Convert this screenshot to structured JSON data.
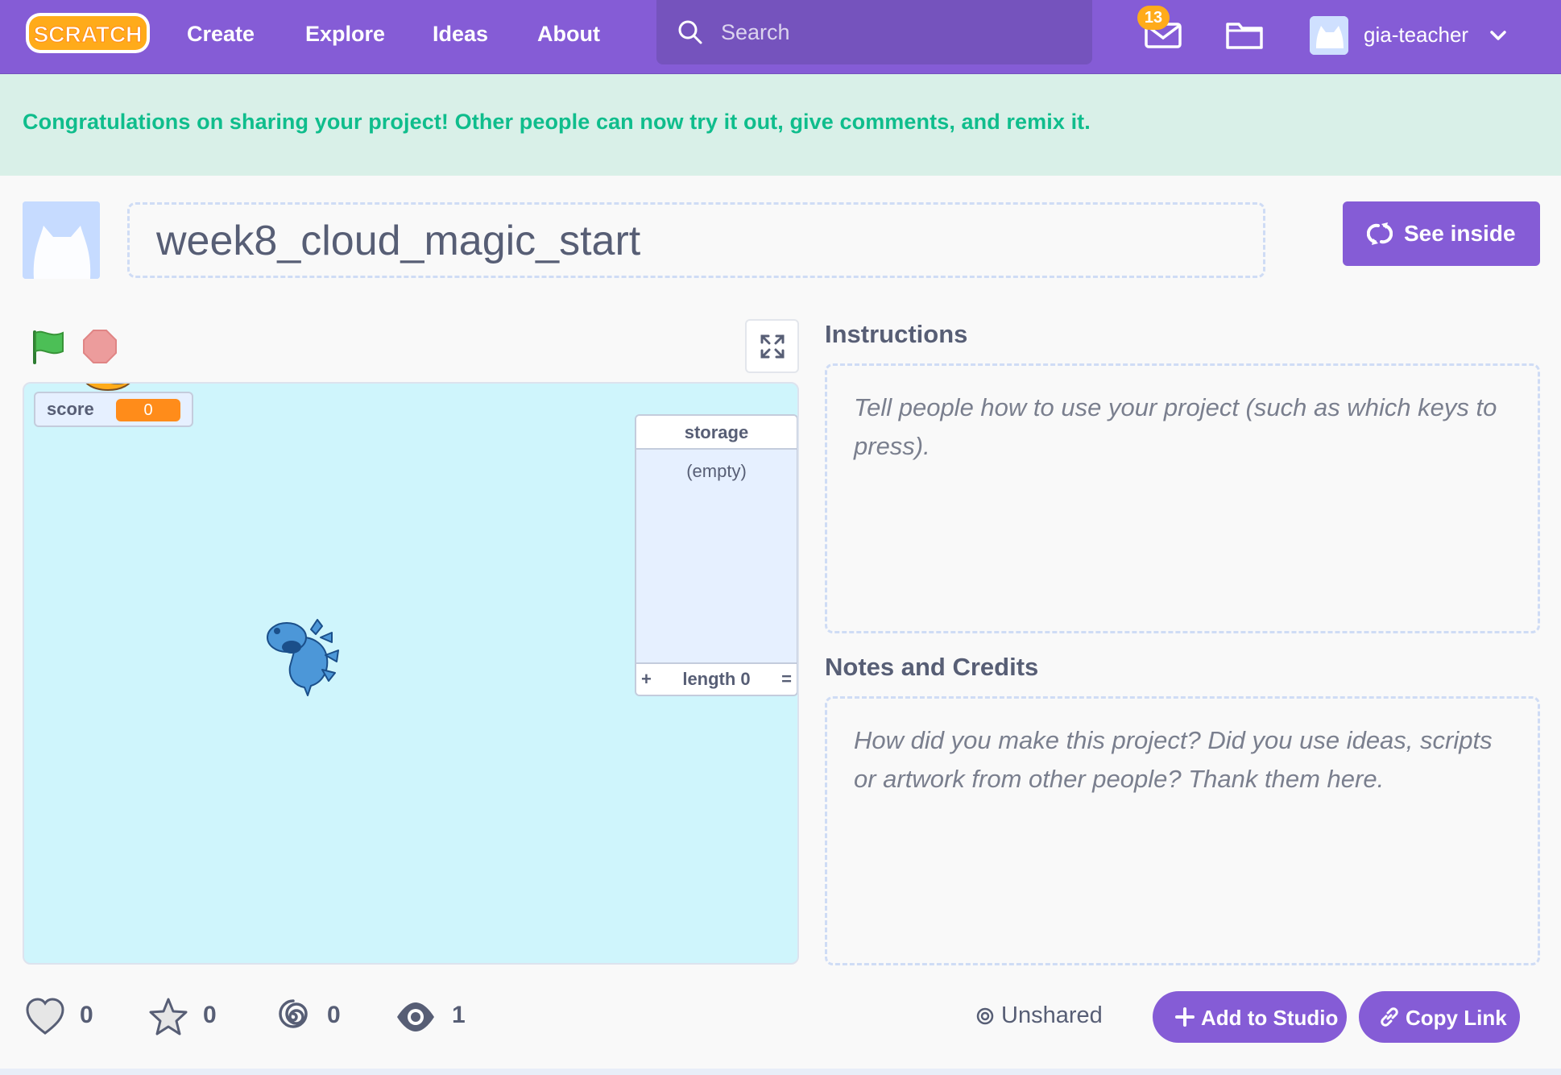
{
  "navbar": {
    "logo_text": "Scratch",
    "links": [
      "Create",
      "Explore",
      "Ideas",
      "About"
    ],
    "search_placeholder": "Search",
    "messages_count": "13",
    "username": "gia-teacher"
  },
  "banner": {
    "text": "Congratulations on sharing your project! Other people can now try it out, give comments, and remix it."
  },
  "project": {
    "title": "week8_cloud_magic_start",
    "see_inside_label": "See inside"
  },
  "stage": {
    "score_monitor": {
      "label": "score",
      "value": "0"
    },
    "list_monitor": {
      "name": "storage",
      "empty_text": "(empty)",
      "add_symbol": "+",
      "length_text": "length 0",
      "resize_symbol": "="
    }
  },
  "instructions": {
    "heading": "Instructions",
    "placeholder": "Tell people how to use your project (such as which keys to press)."
  },
  "notes": {
    "heading": "Notes and Credits",
    "placeholder": "How did you make this project? Did you use ideas, scripts or artwork from other people? Thank them here."
  },
  "stats": {
    "loves": "0",
    "favorites": "0",
    "remixes": "0",
    "views": "1"
  },
  "sharing": {
    "status": "Unshared",
    "add_to_studio_label": "Add to Studio",
    "copy_link_label": "Copy Link"
  },
  "colors": {
    "brand_purple": "#855cd6",
    "banner_green": "#0fbd8c",
    "banner_bg": "#d9f0e8",
    "stage_bg": "#cff5fc",
    "variable_orange": "#ff8c1a"
  }
}
